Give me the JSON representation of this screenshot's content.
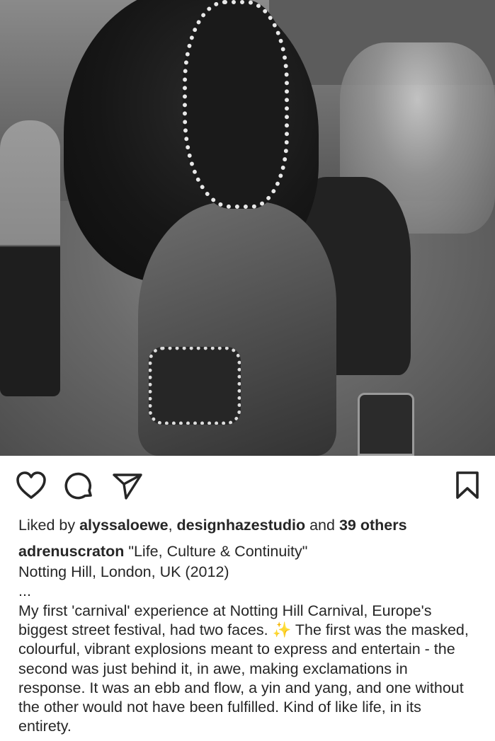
{
  "post": {
    "image_alt": "Black and white photo of a carnival performer in a beaded mask and feathered headdress with a smiling man behind, Notting Hill Carnival street"
  },
  "actions": {
    "like_icon": "heart-icon",
    "comment_icon": "comment-icon",
    "share_icon": "send-icon",
    "save_icon": "bookmark-icon"
  },
  "likes": {
    "prefix": "Liked by ",
    "user1": "alyssaloewe",
    "separator": ", ",
    "user2": "designhazestudio",
    "and": " and ",
    "others": "39 others"
  },
  "caption": {
    "username": "adrenuscraton",
    "title": " \"Life, Culture & Continuity\"",
    "location": "Notting Hill, London, UK (2012)",
    "ellipsis": "...",
    "text_before_emoji": "My first 'carnival' experience at Notting Hill Carnival, Europe's biggest street festival, had two faces. ",
    "emoji": "✨",
    "text_after_emoji": " The first was the masked, colourful, vibrant explosions meant to express and entertain - the second was just behind it, in awe, making exclamations in response. It was an ebb and flow, a yin and yang, and one without the other would not have been fulfilled. Kind of like life, in its entirety."
  }
}
